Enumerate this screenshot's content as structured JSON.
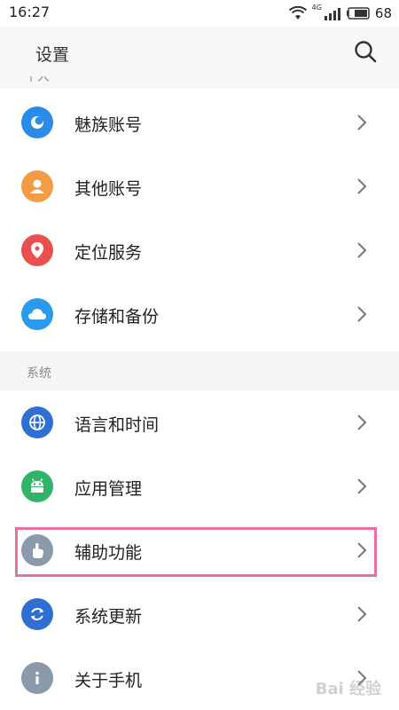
{
  "status": {
    "time": "16:27",
    "network": "4G",
    "battery": "68"
  },
  "header": {
    "title": "设置"
  },
  "partial_section_label": "个人",
  "group_system_label": "系统",
  "rows_top": [
    {
      "label": "魅族账号",
      "icon": "flyme-account-icon",
      "color": "#2a8be8"
    },
    {
      "label": "其他账号",
      "icon": "person-icon",
      "color": "#f39b45"
    },
    {
      "label": "定位服务",
      "icon": "location-pin-icon",
      "color": "#ea5050"
    },
    {
      "label": "存储和备份",
      "icon": "cloud-icon",
      "color": "#2a9bea"
    }
  ],
  "rows_system": [
    {
      "label": "语言和时间",
      "icon": "globe-icon",
      "color": "#2d6fd3"
    },
    {
      "label": "应用管理",
      "icon": "android-icon",
      "color": "#33b36a"
    },
    {
      "label": "辅助功能",
      "icon": "hand-pointer-icon",
      "color": "#8a9aaa"
    },
    {
      "label": "系统更新",
      "icon": "refresh-icon",
      "color": "#2f6fd1"
    },
    {
      "label": "关于手机",
      "icon": "info-icon",
      "color": "#8a9aaa"
    }
  ],
  "highlight_color": "#ec6fa2",
  "watermark": "Bai 经验"
}
